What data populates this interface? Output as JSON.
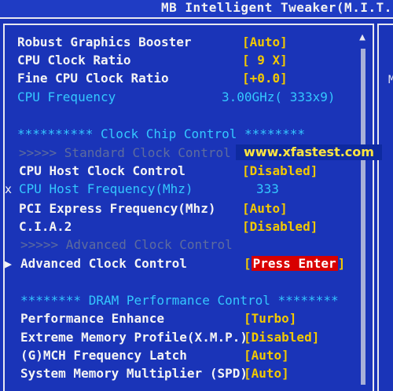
{
  "header": {
    "title": "MB Intelligent Tweaker(M.I.T.)"
  },
  "watermark": "www.xfastest.com",
  "scrollbar": {
    "up_icon": "▲"
  },
  "right_panel": {
    "mark": "M"
  },
  "rows": [
    {
      "label": "Robust Graphics Booster",
      "value": "[Auto]"
    },
    {
      "label": "CPU Clock Ratio",
      "value": "[ 9 X]"
    },
    {
      "label": "Fine CPU Clock Ratio",
      "value": "[+0.0]"
    },
    {
      "label": "CPU Frequency",
      "value": "3.00GHz( 333x9)"
    },
    {
      "label": "**********  Clock Chip Control  ********"
    },
    {
      "label": ">>>>>  Standard Clock Control"
    },
    {
      "label": "CPU Host Clock Control",
      "value": "[Disabled]"
    },
    {
      "marker": "x",
      "label": "CPU Host Frequency(Mhz)",
      "value": "333"
    },
    {
      "label": "PCI Express Frequency(Mhz)",
      "value": "[Auto]"
    },
    {
      "label": "C.I.A.2",
      "value": "[Disabled]"
    },
    {
      "label": ">>>>>  Advanced Clock Control"
    },
    {
      "marker": "▶",
      "label": "Advanced Clock Control",
      "value": "Press Enter"
    },
    {
      "label": "******** DRAM Performance Control ********"
    },
    {
      "label": "Performance Enhance",
      "value": "[Turbo]"
    },
    {
      "label": "Extreme Memory Profile(X.M.P.)",
      "value": "[Disabled]"
    },
    {
      "label": "(G)MCH Frequency Latch",
      "value": "[Auto]"
    },
    {
      "label": "System Memory Multiplier (SPD)",
      "value": "[Auto]"
    }
  ]
}
